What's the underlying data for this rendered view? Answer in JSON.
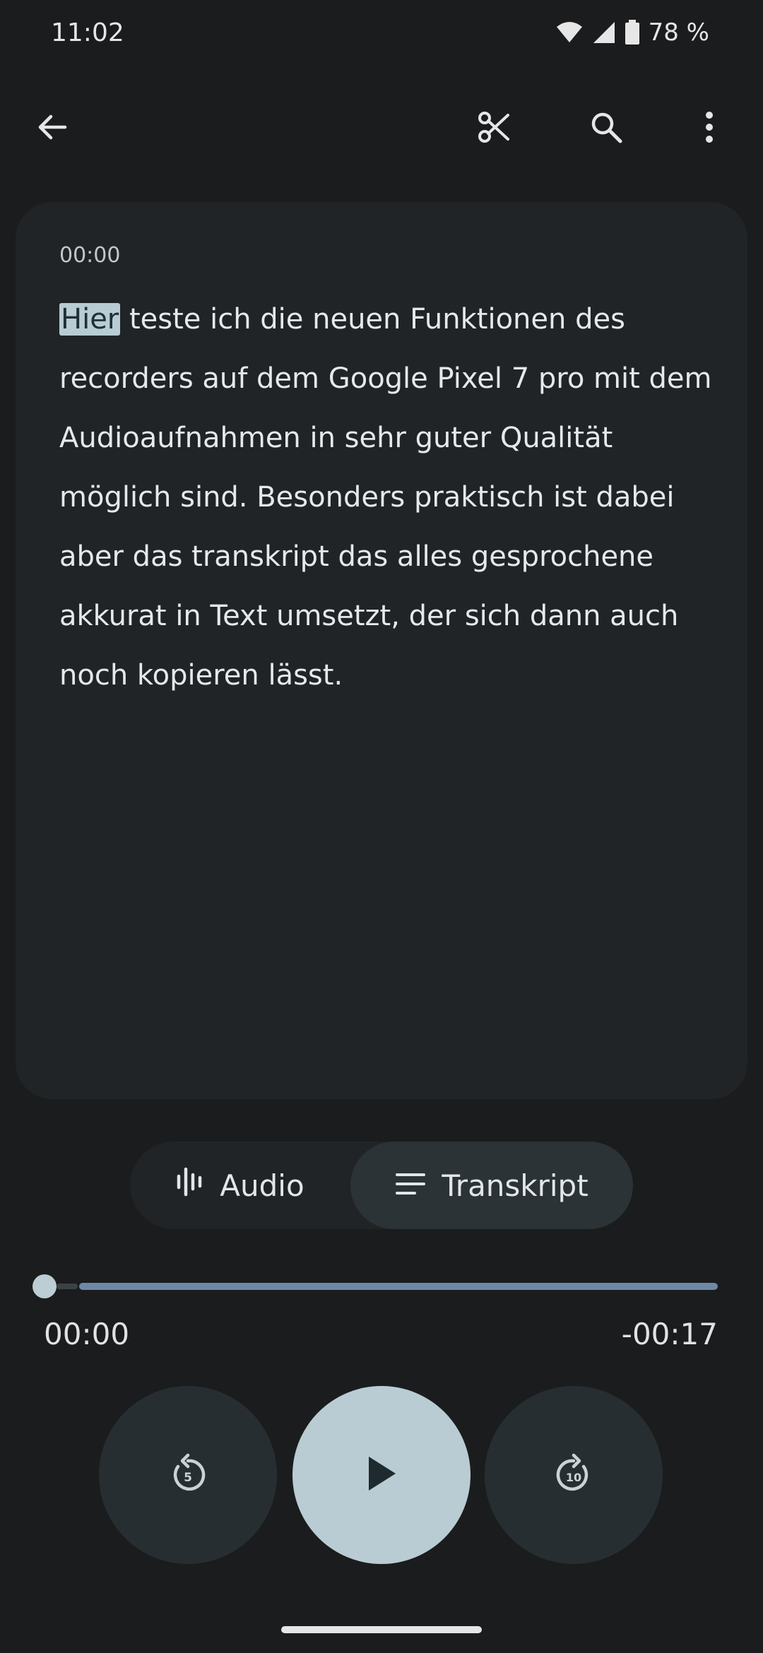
{
  "status_bar": {
    "time": "11:02",
    "battery": "78 %",
    "icons": [
      "wifi-icon",
      "cell-signal-icon",
      "battery-icon"
    ]
  },
  "top_bar": {
    "icons": [
      "back-arrow-icon",
      "scissors-icon",
      "search-icon",
      "more-vert-icon"
    ]
  },
  "transcript": {
    "timestamp": "00:00",
    "highlighted_word": "Hier",
    "text": " teste ich die neuen Funktionen des recorders auf dem Google Pixel 7 pro mit dem Audioaufnahmen in sehr guter Qualität möglich sind. Besonders praktisch ist dabei aber das transkript das alles gesprochene akkurat in Text umsetzt, der sich dann auch noch kopieren lässt."
  },
  "mode_toggle": {
    "audio_label": "Audio",
    "transcript_label": "Transkript",
    "selected": "Transkript"
  },
  "player": {
    "elapsed": "00:00",
    "remaining": "-00:17",
    "progress": 0,
    "rewind_seconds": "5",
    "forward_seconds": "10"
  },
  "colors": {
    "background": "#1b1c1d",
    "card": "#202426",
    "accent": "#b9ccd4",
    "track": "#6f88a6"
  }
}
